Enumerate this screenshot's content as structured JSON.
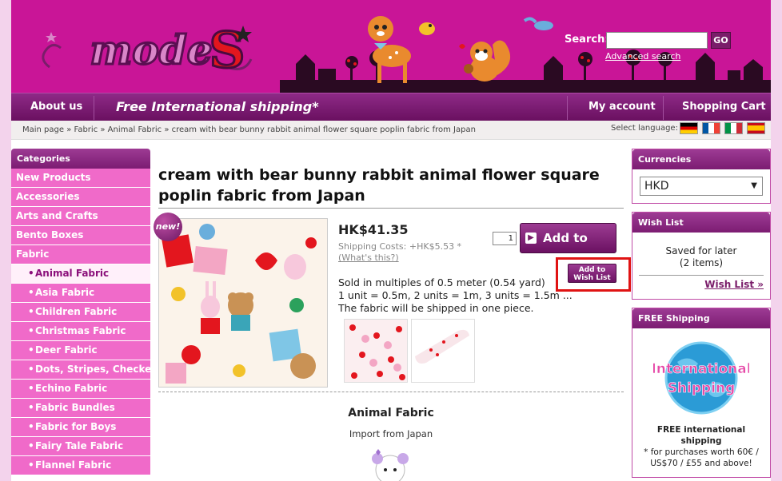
{
  "header": {
    "logo_text": "modeS",
    "search_label": "Search:",
    "search_value": "",
    "go_label": "GO",
    "advanced_search": "Advanced search"
  },
  "nav": {
    "about": "About us",
    "free_shipping": "Free International shipping*",
    "account": "My account",
    "cart": "Shopping Cart"
  },
  "breadcrumb": "Main page » Fabric » Animal Fabric » cream with bear bunny rabbit animal flower square poplin fabric from Japan",
  "language": {
    "label": "Select language:",
    "flags": [
      "de",
      "fr",
      "it",
      "es"
    ]
  },
  "categories": {
    "title": "Categories",
    "items": [
      {
        "label": "New Products",
        "sub": false,
        "active": false
      },
      {
        "label": "Accessories",
        "sub": false,
        "active": false
      },
      {
        "label": "Arts and Crafts",
        "sub": false,
        "active": false
      },
      {
        "label": "Bento Boxes",
        "sub": false,
        "active": false
      },
      {
        "label": "Fabric",
        "sub": false,
        "active": false
      },
      {
        "label": "Animal Fabric",
        "sub": true,
        "active": true
      },
      {
        "label": "Asia Fabric",
        "sub": true,
        "active": false
      },
      {
        "label": "Children Fabric",
        "sub": true,
        "active": false
      },
      {
        "label": "Christmas Fabric",
        "sub": true,
        "active": false
      },
      {
        "label": "Deer Fabric",
        "sub": true,
        "active": false
      },
      {
        "label": "Dots, Stripes, Checker",
        "sub": true,
        "active": false
      },
      {
        "label": "Echino Fabric",
        "sub": true,
        "active": false
      },
      {
        "label": "Fabric Bundles",
        "sub": true,
        "active": false
      },
      {
        "label": "Fabric for Boys",
        "sub": true,
        "active": false
      },
      {
        "label": "Fairy Tale Fabric",
        "sub": true,
        "active": false
      },
      {
        "label": "Flannel Fabric",
        "sub": true,
        "active": false
      }
    ]
  },
  "product": {
    "title": "cream with bear bunny rabbit animal flower square poplin fabric from Japan",
    "new_badge": "new!",
    "price": "HK$41.35",
    "shipping_text": "Shipping Costs: +HK$5.53 * ",
    "shipping_link": "(What's this?)",
    "quantity": "1",
    "add_to_cart": "Add to Cart",
    "wish_line1": "Add to",
    "wish_line2": "Wish List",
    "desc_line1": "Sold in multiples of 0.5 meter (0.54 yard)",
    "desc_line2": "1 unit = 0.5m, 2 units = 1m, 3 units = 1.5m ...",
    "desc_line3": "The fabric will be shipped in one piece."
  },
  "section": {
    "title": "Animal Fabric",
    "subtitle": "Import from Japan"
  },
  "currencies": {
    "title": "Currencies",
    "selected": "HKD"
  },
  "wishlist": {
    "title": "Wish List",
    "line1": "Saved for later",
    "line2": "(2 items)",
    "link": "Wish List »"
  },
  "free_shipping_box": {
    "title": "FREE Shipping",
    "image_line1": "International",
    "image_line2": "Shipping",
    "bold_line": "FREE international shipping",
    "line2": "* for purchases worth 60€ /",
    "line3": "US$70 / £55 and above!"
  },
  "colors": {
    "header_magenta": "#c91597",
    "nav_purple": "#7a1d6a",
    "category_pink": "#f06ac9",
    "highlight_red": "#e01313"
  }
}
